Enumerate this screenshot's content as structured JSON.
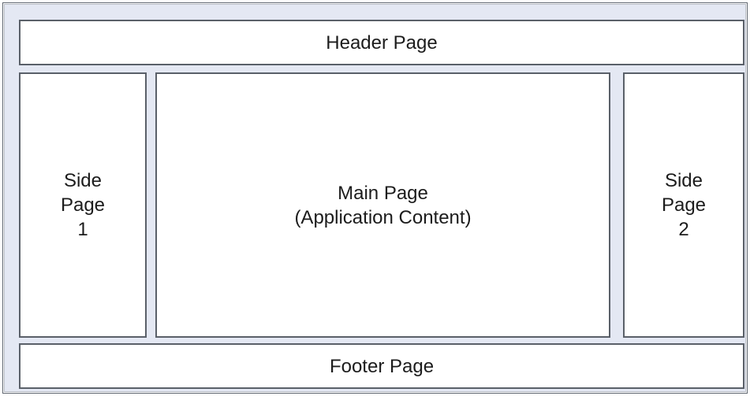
{
  "diagram": {
    "header": {
      "label": "Header Page"
    },
    "side_left": {
      "label": "Side\nPage\n1"
    },
    "main": {
      "label": "Main Page\n(Application Content)"
    },
    "side_right": {
      "label": "Side\nPage\n2"
    },
    "footer": {
      "label": "Footer Page"
    }
  },
  "colors": {
    "background": "#e4e8f3",
    "panel": "#ffffff",
    "border": "#5a6069",
    "text": "#1c1c1c"
  }
}
